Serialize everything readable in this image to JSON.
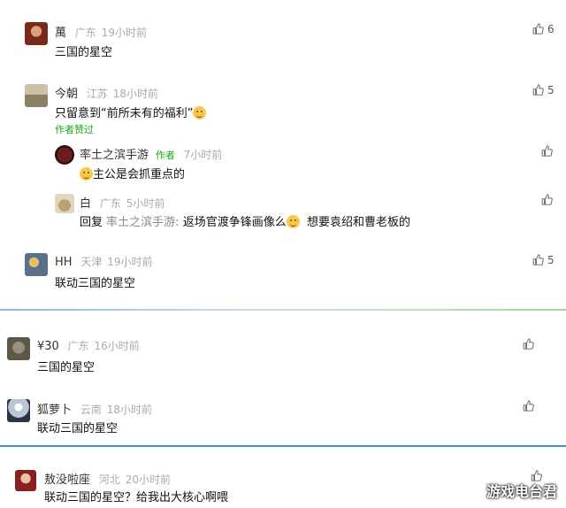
{
  "comments": [
    {
      "name": "萬",
      "location": "广东",
      "time": "19小时前",
      "text": "三国的星空",
      "likes": "6"
    },
    {
      "name": "今朝",
      "location": "江苏",
      "time": "18小时前",
      "text": "只留意到“前所未有的福利”",
      "likes": "5",
      "badge": "作者赞过",
      "replies": [
        {
          "name": "率土之滨手游",
          "author_tag": "作者",
          "time": "7小时前",
          "text": "主公是会抓重点的"
        },
        {
          "name": "白",
          "location": "广东",
          "time": "5小时前",
          "reply_prefix": "回复",
          "reply_to": "率土之滨手游:",
          "text": "返场官渡争锋画像么",
          "text_after": "  想要袁绍和曹老板的"
        }
      ]
    },
    {
      "name": "HH",
      "location": "天津",
      "time": "19小时前",
      "text": "联动三国的星空",
      "likes": "5"
    },
    {
      "name": "¥30",
      "location": "广东",
      "time": "16小时前",
      "text": "三国的星空"
    },
    {
      "name": "狐萝卜",
      "location": "云南",
      "time": "18小时前",
      "text": "联动三国的星空"
    },
    {
      "name": "敖没啦座",
      "location": "河北",
      "time": "20小时前",
      "text": "联动三国的星空？给我出大核心啊喂"
    }
  ],
  "watermark": "游戏电台君",
  "icons": {
    "like": "thumb-up-icon",
    "emoji_smile": "smile-emoji-icon",
    "emoji_cry": "crying-emoji-icon"
  },
  "colors": {
    "name": "#333333",
    "meta": "#aaaaaa",
    "badge": "#1aad19",
    "divider_blue": "#4a90c8"
  }
}
